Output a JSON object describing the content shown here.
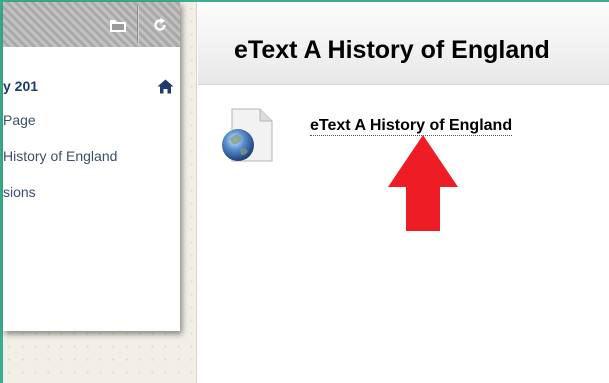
{
  "course_menu": {
    "course_title": "y 201",
    "items": [
      {
        "label": "Page"
      },
      {
        "label": " History of England"
      },
      {
        "label": "sions"
      }
    ],
    "icons": {
      "folder": "folder-icon",
      "refresh": "refresh-icon",
      "home": "home-icon"
    }
  },
  "content": {
    "page_title": "eText A History of England",
    "item_title": "eText A History of England",
    "item_icon": "globe-file-icon"
  },
  "annotation": {
    "arrow": "red-arrow-pointer"
  },
  "colors": {
    "frame_accent": "#3cae8f",
    "menu_text": "#1e3b6b",
    "arrow_red": "#ee1c24"
  }
}
